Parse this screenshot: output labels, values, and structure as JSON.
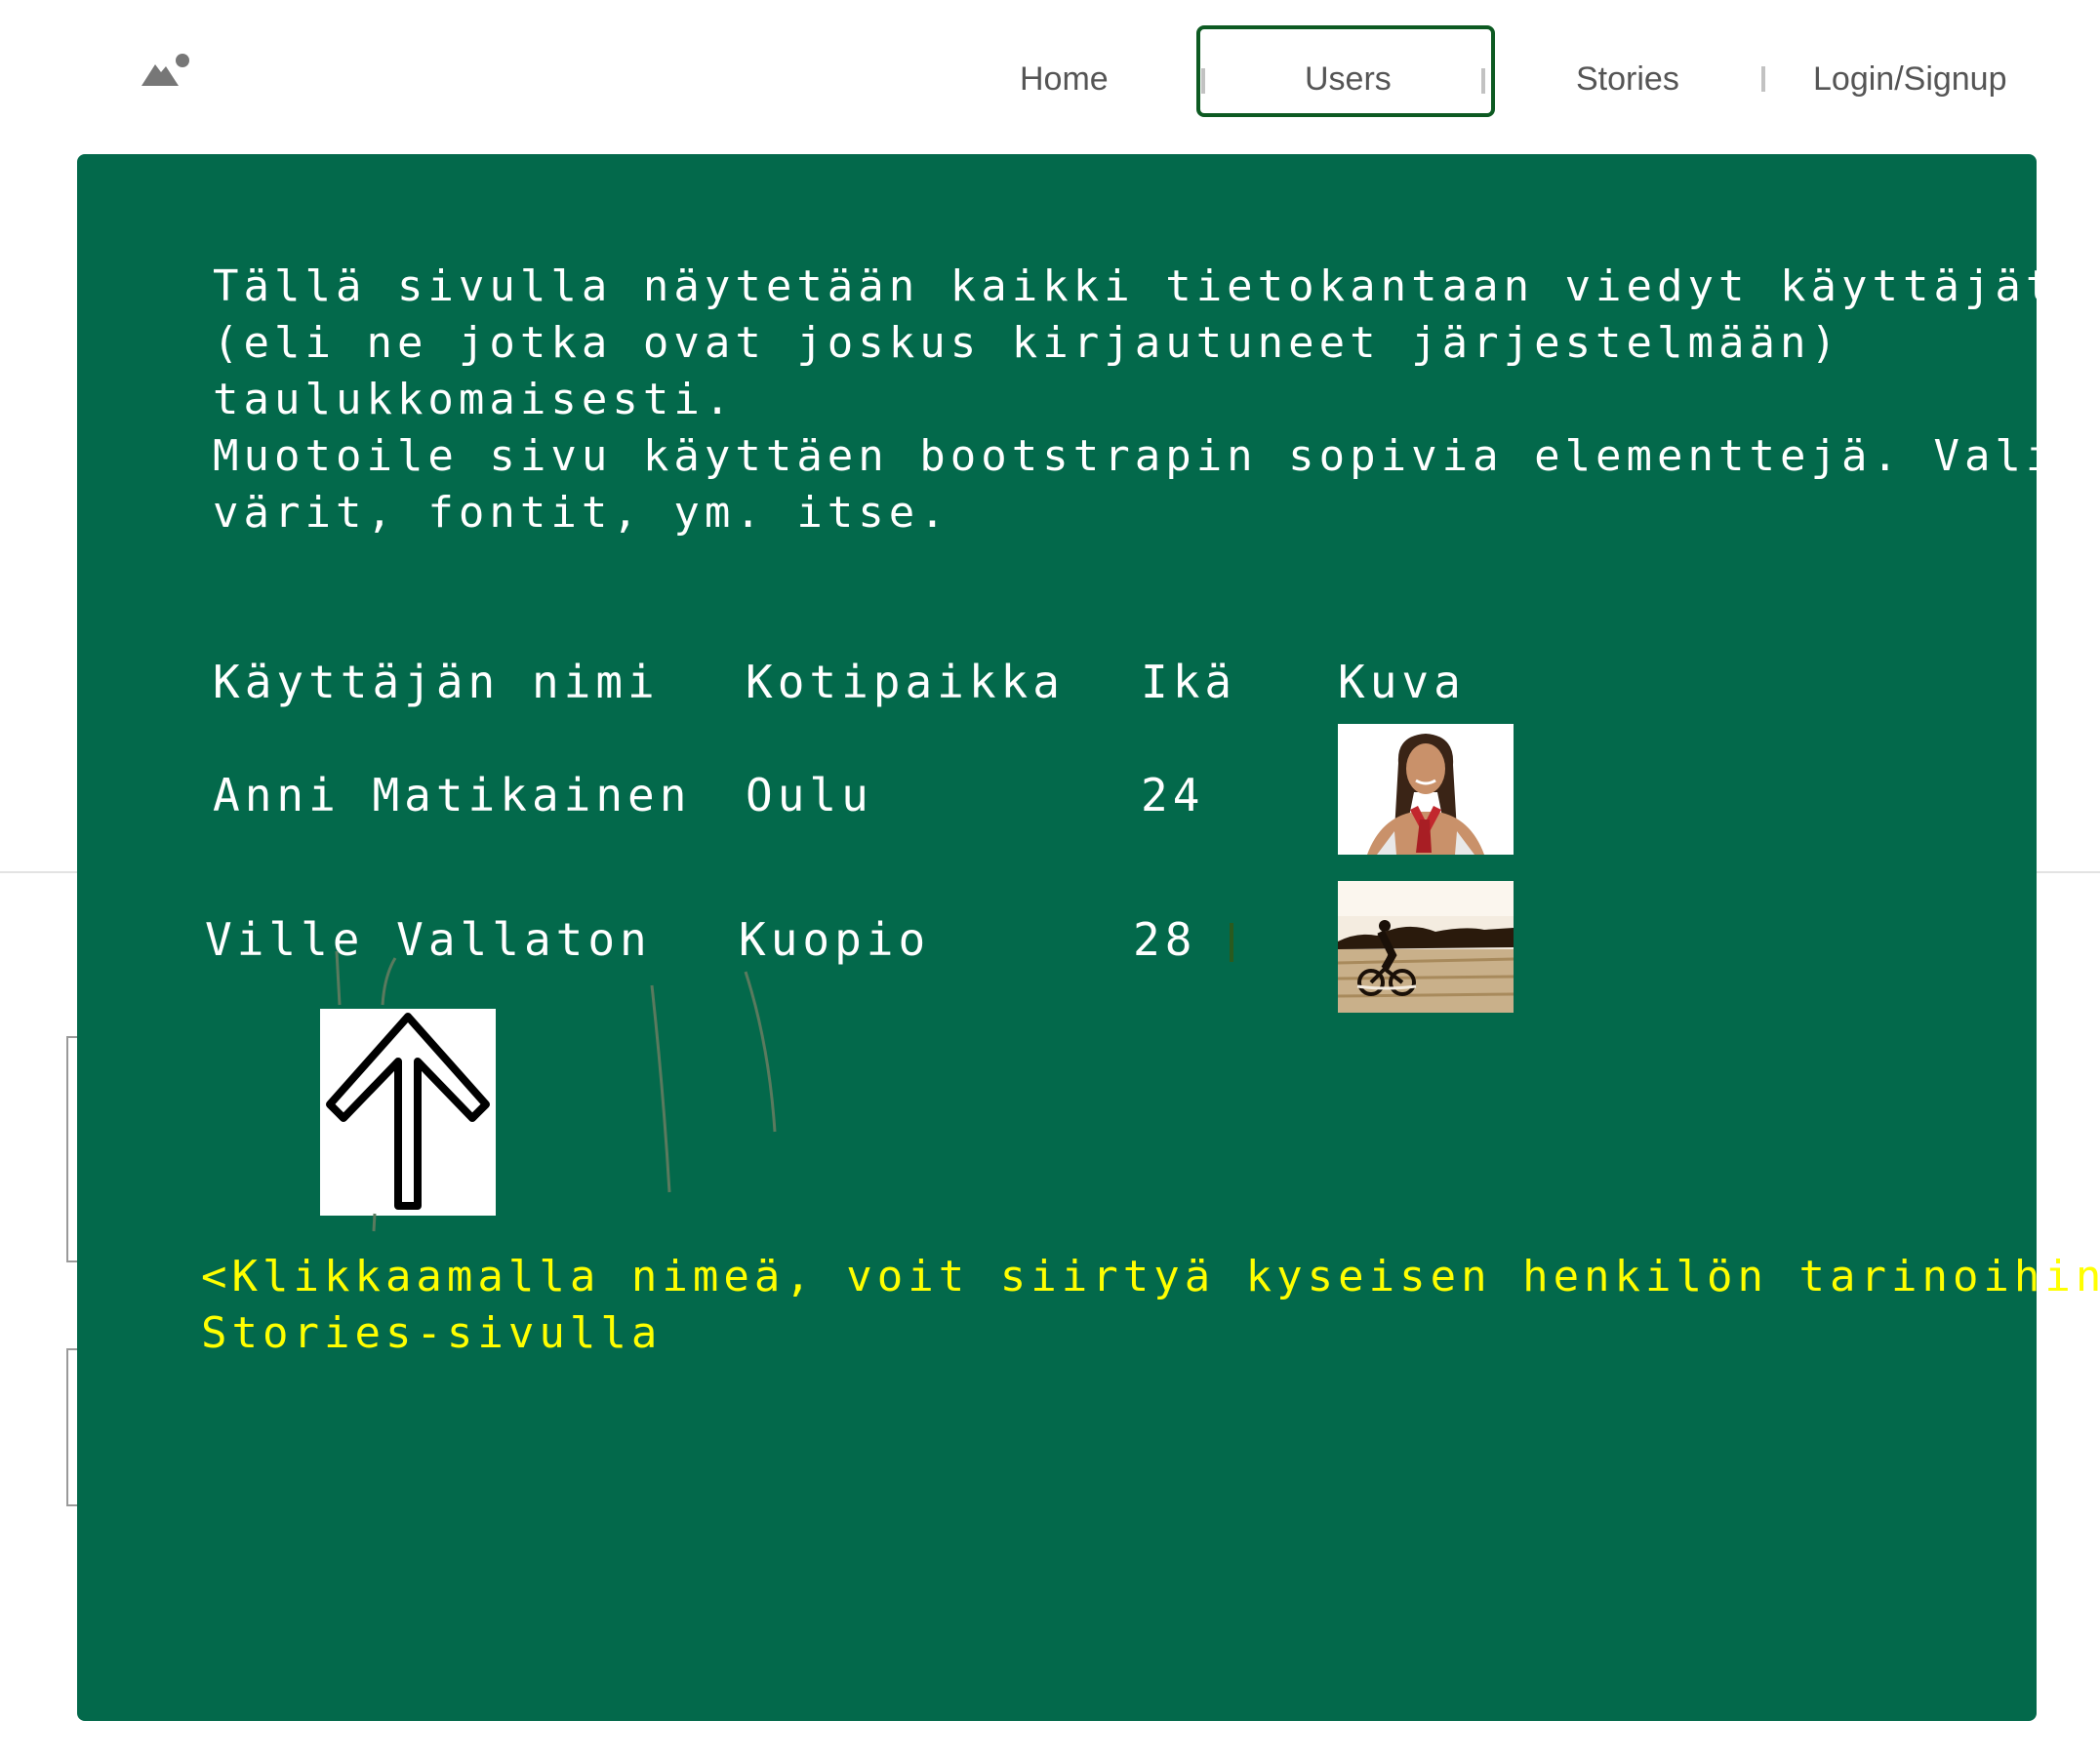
{
  "nav": {
    "home": "Home",
    "users": "Users",
    "stories": "Stories",
    "login": "Login/Signup",
    "active": "Users"
  },
  "logo_icon": "image-icon",
  "colors": {
    "panel": "#03694b",
    "active_border": "#0d5a22",
    "note_text": "#ffff00",
    "body_text": "#ffffff"
  },
  "intro": {
    "lines": [
      "Tällä sivulla näytetään kaikki tietokantaan viedyt käyttäjät",
      "(eli ne jotka ovat joskus kirjautuneet järjestelmään)",
      "taulukkomaisesti.",
      "Muotoile sivu käyttäen bootstrapin sopivia elementtejä. Valitse",
      "värit, fontit, ym. itse."
    ]
  },
  "table": {
    "headers": [
      "Käyttäjän nimi",
      "Kotipaikka",
      "Ikä",
      "Kuva"
    ],
    "rows": [
      {
        "name": "Anni Matikainen",
        "city": "Oulu",
        "age": "24",
        "photo": "woman-portrait"
      },
      {
        "name": "Ville Vallaton",
        "city": "Kuopio",
        "age": "28",
        "photo": "cyclist-lake"
      }
    ]
  },
  "arrow_icon": "arrow-up-icon",
  "note": {
    "lines": [
      "<Klikkaamalla nimeä, voit siirtyä kyseisen henkilön tarinoihin",
      "Stories-sivulla"
    ]
  }
}
